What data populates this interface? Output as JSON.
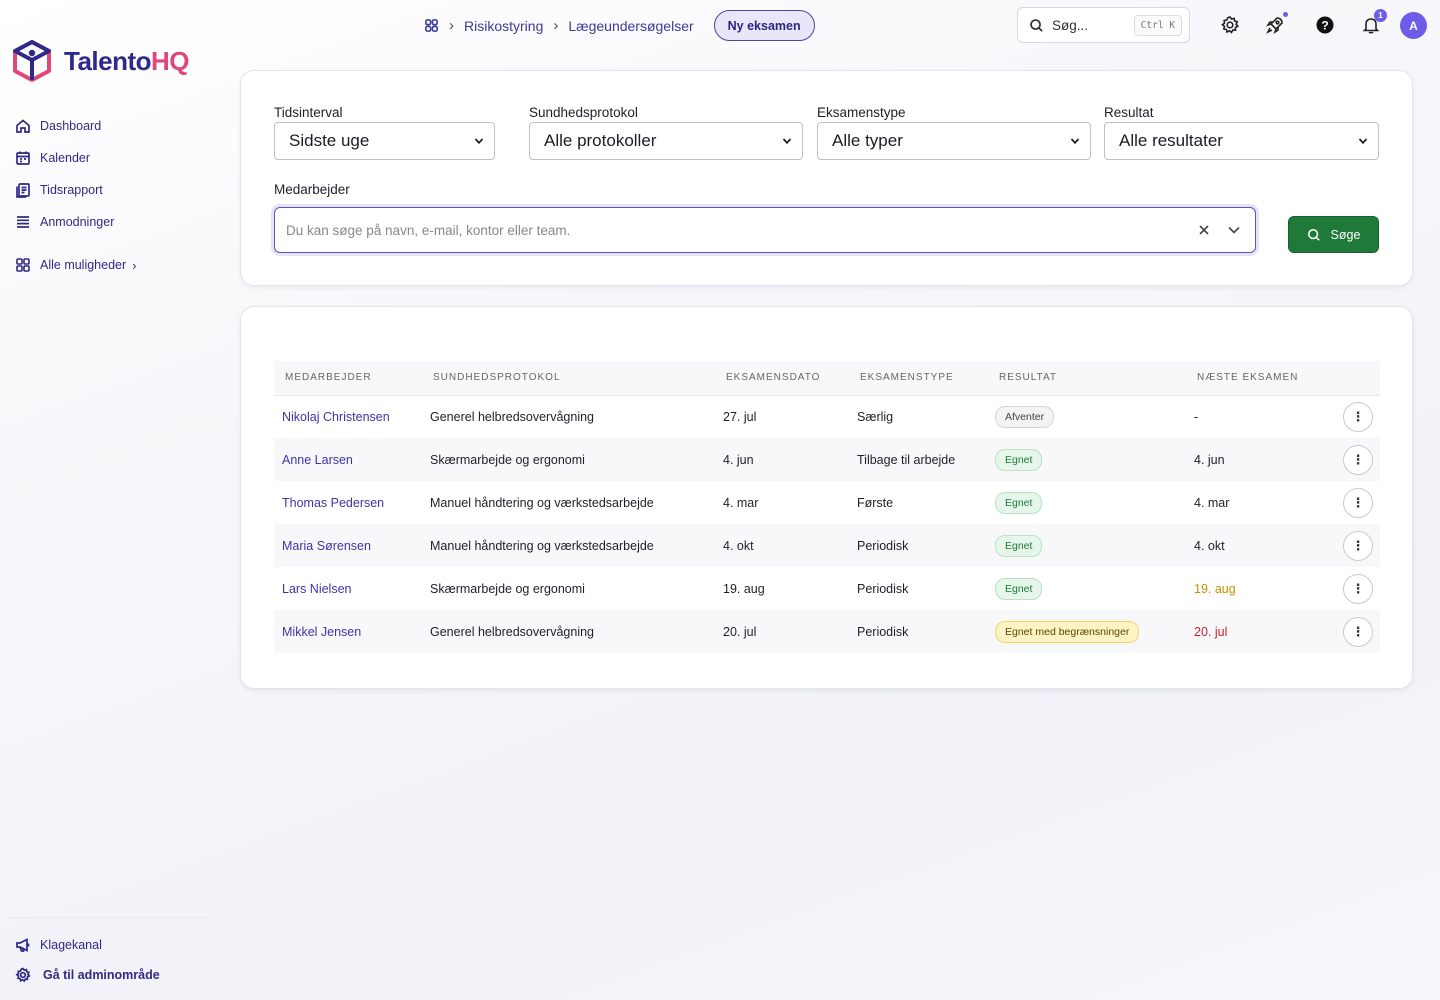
{
  "brand": {
    "name_part1": "Talento",
    "name_part2": "HQ",
    "color_primary": "#2d2a8a",
    "color_accent": "#e0457b"
  },
  "sidebar": {
    "items": [
      {
        "label": "Dashboard",
        "icon": "home-icon"
      },
      {
        "label": "Kalender",
        "icon": "calendar-icon"
      },
      {
        "label": "Tidsrapport",
        "icon": "report-icon"
      },
      {
        "label": "Anmodninger",
        "icon": "list-icon"
      }
    ],
    "more_label": "Alle muligheder",
    "bottom_items": [
      {
        "label": "Klagekanal",
        "icon": "megaphone-icon"
      },
      {
        "label": "Gå til adminområde",
        "icon": "gear-icon"
      }
    ]
  },
  "breadcrumb": {
    "items": [
      "Risikostyring",
      "Lægeundersøgelser"
    ],
    "action_label": "Ny eksamen"
  },
  "topbar": {
    "search_placeholder": "Søg...",
    "search_shortcut": "Ctrl K",
    "notification_count": "1",
    "avatar_initial": "A"
  },
  "filters": {
    "time_label": "Tidsinterval",
    "time_value": "Sidste uge",
    "protocol_label": "Sundhedsprotokol",
    "protocol_value": "Alle protokoller",
    "type_label": "Eksamenstype",
    "type_value": "Alle typer",
    "result_label": "Resultat",
    "result_value": "Alle resultater",
    "employee_label": "Medarbejder",
    "employee_placeholder": "Du kan søge på navn, e-mail, kontor eller team.",
    "search_button": "Søge"
  },
  "table": {
    "headers": [
      "Medarbejder",
      "Sundhedsprotokol",
      "Eksamensdato",
      "Eksamenstype",
      "Resultat",
      "Næste eksamen"
    ],
    "rows": [
      {
        "employee": "Nikolaj Christensen",
        "protocol": "Generel helbredsovervågning",
        "date": "27. jul",
        "type": "Særlig",
        "result": "Afventer",
        "result_style": "grey",
        "next": "-",
        "next_style": "normal"
      },
      {
        "employee": "Anne Larsen",
        "protocol": "Skærmarbejde og ergonomi",
        "date": "4. jun",
        "type": "Tilbage til arbejde",
        "result": "Egnet",
        "result_style": "green",
        "next": "4. jun",
        "next_style": "normal"
      },
      {
        "employee": "Thomas Pedersen",
        "protocol": "Manuel håndtering og værkstedsarbejde",
        "date": "4. mar",
        "type": "Første",
        "result": "Egnet",
        "result_style": "green",
        "next": "4. mar",
        "next_style": "normal"
      },
      {
        "employee": "Maria Sørensen",
        "protocol": "Manuel håndtering og værkstedsarbejde",
        "date": "4. okt",
        "type": "Periodisk",
        "result": "Egnet",
        "result_style": "green",
        "next": "4. okt",
        "next_style": "normal"
      },
      {
        "employee": "Lars Nielsen",
        "protocol": "Skærmarbejde og ergonomi",
        "date": "19. aug",
        "type": "Periodisk",
        "result": "Egnet",
        "result_style": "green",
        "next": "19. aug",
        "next_style": "warn"
      },
      {
        "employee": "Mikkel Jensen",
        "protocol": "Generel helbredsovervågning",
        "date": "20. jul",
        "type": "Periodisk",
        "result": "Egnet med begrænsninger",
        "result_style": "yellow",
        "next": "20. jul",
        "next_style": "danger"
      }
    ]
  }
}
